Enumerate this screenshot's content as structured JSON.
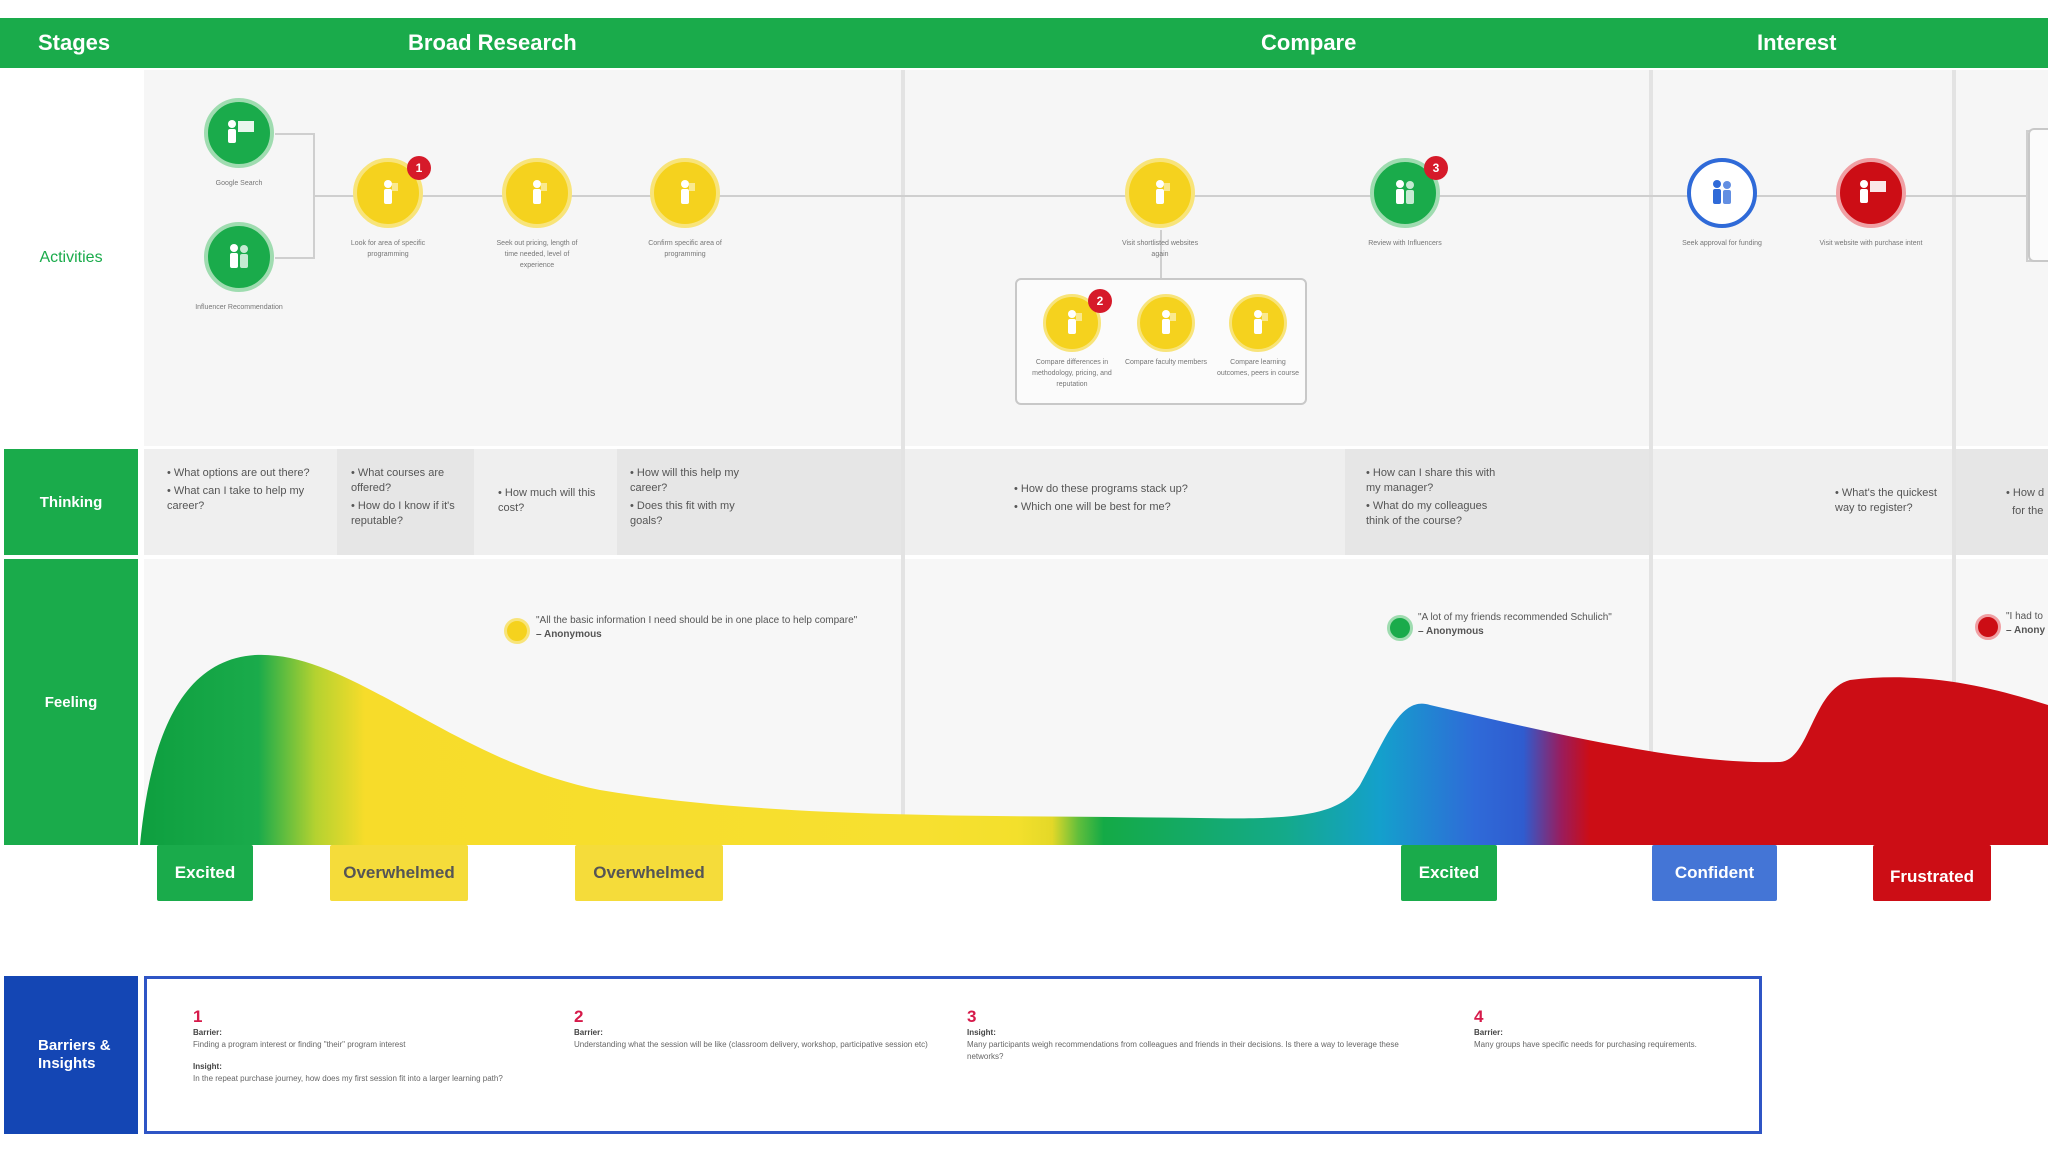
{
  "header": {
    "stages_label": "Stages",
    "stages": [
      "Broad Research",
      "Compare",
      "Interest"
    ]
  },
  "rows": {
    "activities": "Activities",
    "thinking": "Thinking",
    "feeling": "Feeling",
    "barriers": "Barriers & Insights"
  },
  "colors": {
    "header_green": "#1aab4b",
    "yellow": "#f5d21e",
    "green": "#1aab4b",
    "blue": "#2f6ad8",
    "red": "#cc0d15",
    "badge_red": "#d61a2a",
    "barrier_blue": "#1446b4"
  },
  "activities": [
    {
      "caption": "Google Search",
      "color": "green",
      "icon": "presenter-icon"
    },
    {
      "caption": "Influencer Recommendation",
      "color": "green",
      "icon": "people-icon"
    },
    {
      "caption": "Look for area of specific programming",
      "color": "yellow",
      "badge": "1",
      "icon": "person-icon"
    },
    {
      "caption": "Seek out pricing, length of time needed, level of experience",
      "color": "yellow",
      "icon": "person-icon"
    },
    {
      "caption": "Confirm specific area of programming",
      "color": "yellow",
      "icon": "person-icon"
    },
    {
      "caption": "Visit shortlisted websites again",
      "color": "yellow",
      "icon": "person-icon"
    },
    {
      "caption": "Review with Influencers",
      "color": "green",
      "badge": "3",
      "icon": "people-icon"
    },
    {
      "caption": "Seek approval for funding",
      "color": "blue",
      "icon": "people-icon"
    },
    {
      "caption": "Visit website with purchase intent",
      "color": "red",
      "icon": "presenter-icon"
    }
  ],
  "compare_sub": [
    {
      "caption": "Compare differences in methodology, pricing, and reputation",
      "badge": "2"
    },
    {
      "caption": "Compare faculty members"
    },
    {
      "caption": "Compare learning outcomes, peers in course"
    }
  ],
  "thinking": [
    [
      "What options are out there?",
      "What can I take to help my career?"
    ],
    [
      "What courses are offered?",
      "How do I know if it's reputable?"
    ],
    [
      "How much will this cost?"
    ],
    [
      "How will this help my career?",
      "Does this fit with my goals?"
    ],
    [
      "How do these programs stack up?",
      "Which one will be best for me?"
    ],
    [
      "How can I share this with my manager?",
      "What do my colleagues think of the course?"
    ],
    [
      "What's the quickest way to register?"
    ],
    [
      "How d",
      "for the"
    ]
  ],
  "quotes": [
    {
      "text": "\"All the basic information I need should be in one place to help compare\"",
      "author": "– Anonymous",
      "color": "yellow"
    },
    {
      "text": "\"A lot of my friends recommended Schulich\"",
      "author": "– Anonymous",
      "color": "green"
    },
    {
      "text": "\"I had to",
      "author": "– Anony",
      "color": "red"
    }
  ],
  "feelings": [
    "Excited",
    "Overwhelmed",
    "Overwhelmed",
    "Excited",
    "Confident",
    "Frustrated"
  ],
  "barriers": [
    {
      "num": "1",
      "barrier_label": "Barrier:",
      "barrier": "Finding a program interest or finding \"their\" program interest",
      "insight_label": "Insight:",
      "insight": "In the repeat purchase journey, how does my first session fit into a larger learning path?"
    },
    {
      "num": "2",
      "barrier_label": "Barrier:",
      "barrier": "Understanding what the session will be like (classroom delivery, workshop, participative session etc)"
    },
    {
      "num": "3",
      "barrier_label": "Insight:",
      "barrier": "Many participants weigh recommendations from colleagues and friends in their decisions. Is there a way to leverage these networks?"
    },
    {
      "num": "4",
      "barrier_label": "Barrier:",
      "barrier": "Many groups have specific needs for purchasing requirements."
    }
  ]
}
